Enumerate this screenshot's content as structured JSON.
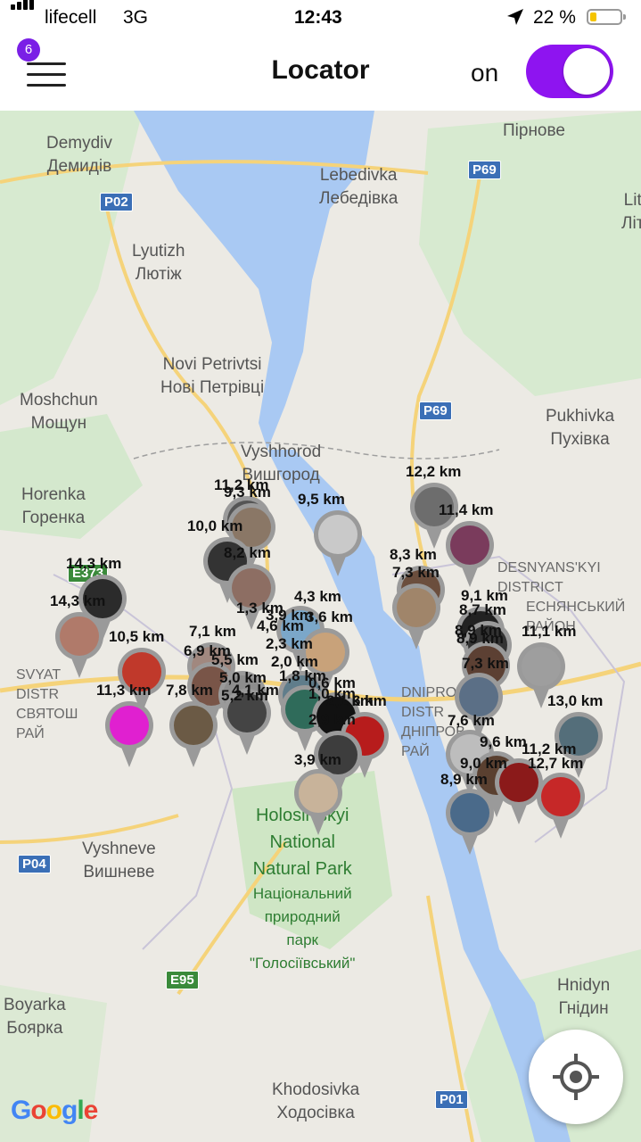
{
  "status_bar": {
    "carrier": "lifecell",
    "network": "3G",
    "time": "12:43",
    "battery_text": "22 %",
    "battery_level": 0.22
  },
  "header": {
    "notification_count": "6",
    "title": "Locator",
    "toggle_label": "on",
    "toggle_on": true,
    "accent_color": "#8e14f0"
  },
  "map": {
    "places": [
      {
        "en": "Demydiv",
        "local": "Демидів"
      },
      {
        "en": "Lebedivka",
        "local": "Лебедівка"
      },
      {
        "en": "Lyutizh",
        "local": "Лютіж"
      },
      {
        "en": "Novi Petrivtsi",
        "local": "Нові Петрівці"
      },
      {
        "en": "Moshchun",
        "local": "Мощун"
      },
      {
        "en": "Horenka",
        "local": "Горенка"
      },
      {
        "en": "Vyshhorod",
        "local": "Вишгород"
      },
      {
        "en": "Pukhivka",
        "local": "Пухівка"
      },
      {
        "en": "Vyshneve",
        "local": "Вишневе"
      },
      {
        "en": "Boyarka",
        "local": "Боярка"
      },
      {
        "en": "Hnidyn",
        "local": "Гнідин"
      },
      {
        "en": "Khodosivka",
        "local": "Ходосівка"
      },
      {
        "en": "",
        "local": "Пірнове"
      },
      {
        "en": "Lit",
        "local": "Літ"
      }
    ],
    "district_labels": [
      "DESNYANS'KYI",
      "DISTRICT",
      "ЕСНЯНСЬКИЙ",
      "РАЙОН",
      "SVYAT",
      "DISTR",
      "СВЯТОШ",
      "РАЙ",
      "DNIPROV",
      "DISTR",
      "ДНІПРОВ",
      "РАЙ"
    ],
    "park": [
      "Holosiivskyi",
      "National",
      "Natural Park",
      "Національний",
      "природний",
      "парк",
      "\"Голосіївський\""
    ],
    "roads": [
      "P02",
      "P69",
      "P69",
      "E373",
      "P04",
      "E95",
      "P01"
    ],
    "attribution": "Google"
  },
  "pins": [
    {
      "dist": "12,2 km",
      "color": "#6d6d6d"
    },
    {
      "dist": "11,4 km",
      "color": "#7a3b5c"
    },
    {
      "dist": "11,2 km",
      "color": "#555555"
    },
    {
      "dist": "9,5 km",
      "color": "#c9c9c9"
    },
    {
      "dist": "9,3 km",
      "color": "#8a7766"
    },
    {
      "dist": "10,0 km",
      "color": "#333333"
    },
    {
      "dist": "8,2 km",
      "color": "#8d6e63"
    },
    {
      "dist": "8,3 km",
      "color": "#6b4e3d"
    },
    {
      "dist": "7,3 km",
      "color": "#a0856a"
    },
    {
      "dist": "14,3 km",
      "color": "#2b2b2b"
    },
    {
      "dist": "14,3 km",
      "color": "#b07a6a"
    },
    {
      "dist": "4,3 km",
      "color": "#7ba7c9"
    },
    {
      "dist": "3,6 km",
      "color": "#c8a27a"
    },
    {
      "dist": "9,1 km",
      "color": "#222222"
    },
    {
      "dist": "8,7 km",
      "color": "#333333"
    },
    {
      "dist": "8,9 km",
      "color": "#5c4033"
    },
    {
      "dist": "11,1 km",
      "color": "#9e9e9e"
    },
    {
      "dist": "10,5 km",
      "color": "#c0392b"
    },
    {
      "dist": "7,1 km",
      "color": "#a1887f"
    },
    {
      "dist": "6,9 km",
      "color": "#795548"
    },
    {
      "dist": "5,5 km",
      "color": "#8d8d8d"
    },
    {
      "dist": "2,0 km",
      "color": "#607d8b"
    },
    {
      "dist": "11,3 km",
      "color": "#e020d0"
    },
    {
      "dist": "7,8 km",
      "color": "#6b5a45"
    },
    {
      "dist": "5,0 km",
      "color": "#444444"
    },
    {
      "dist": "1,8 km",
      "color": "#2f6b5a"
    },
    {
      "dist": "0,6 km",
      "color": "#111111"
    },
    {
      "dist": "7,3 km",
      "color": "#5b6f86"
    },
    {
      "dist": "13,0 km",
      "color": "#546e7a"
    },
    {
      "dist": "2,1 km",
      "color": "#b71c1c"
    },
    {
      "dist": "2,9 km",
      "color": "#3d3d3d"
    },
    {
      "dist": "3,9 km",
      "color": "#c8b39a"
    },
    {
      "dist": "7,6 km",
      "color": "#bdbdbd"
    },
    {
      "dist": "9,6 km",
      "color": "#5a4030"
    },
    {
      "dist": "11,2 km",
      "color": "#8b1a1a"
    },
    {
      "dist": "12,7 km",
      "color": "#c62828"
    },
    {
      "dist": "8,9 km",
      "color": "#4a6a8a"
    }
  ],
  "extra_labels": [
    "1,3 km",
    "4,6 km",
    "3,9 km",
    "2,3 km",
    "1,0 km",
    "6 km",
    "5,2 km",
    "4,1 km",
    "8,9 km",
    "9,0 km"
  ],
  "icons": {
    "menu": "hamburger-menu-icon",
    "location": "crosshair-locate-icon",
    "gps": "location-arrow-icon"
  }
}
